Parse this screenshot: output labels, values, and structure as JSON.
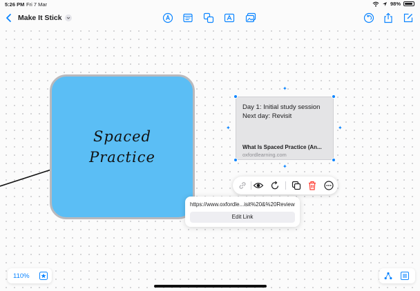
{
  "status_bar": {
    "time": "5:26 PM",
    "date": "Fri 7 Mar",
    "battery": "98%"
  },
  "toolbar": {
    "title": "Make It Stick",
    "tools": [
      "pen-tip-icon",
      "text-box-icon",
      "shapes-icon",
      "text-icon",
      "media-icon"
    ],
    "right_tools": [
      "undo-icon",
      "share-icon",
      "compose-icon"
    ]
  },
  "sticky_note": {
    "line1": "Spaced",
    "line2": "Practice",
    "color": "#5bbef5"
  },
  "link_card": {
    "line1": "Day 1: Initial study session",
    "line2": "Next day: Revisit",
    "preview_title": "What Is Spaced Practice (An...",
    "domain": "oxfordlearning.com"
  },
  "context_menu": {
    "items": [
      "link-icon",
      "eye-icon",
      "refresh-icon",
      "duplicate-icon",
      "trash-icon",
      "more-icon"
    ]
  },
  "link_popover": {
    "url": "https://www.oxfordle...isit%20&%20Review",
    "edit_label": "Edit Link"
  },
  "bottom": {
    "zoom": "110%"
  },
  "colors": {
    "accent": "#0a84ff",
    "danger": "#ff3b30"
  }
}
